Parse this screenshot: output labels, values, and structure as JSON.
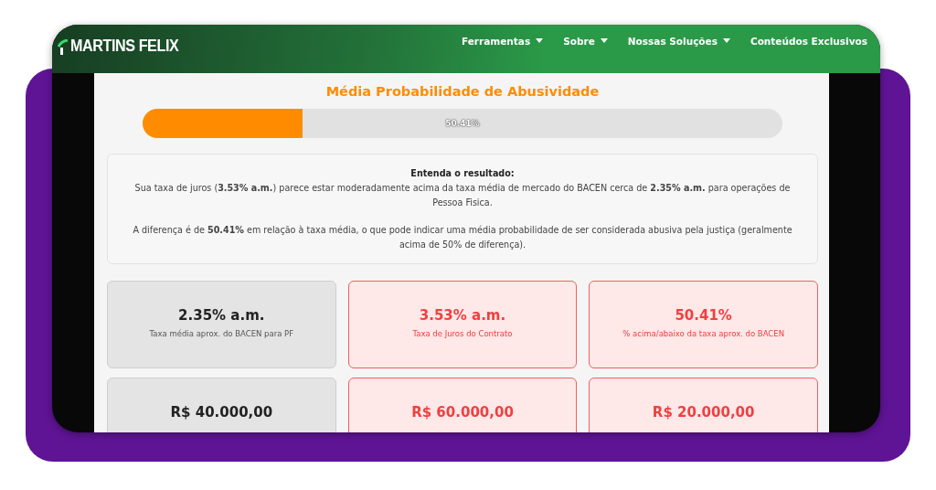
{
  "header": {
    "logo": "MARTINS FELIX",
    "nav": [
      {
        "label": "Ferramentas",
        "dropdown": true
      },
      {
        "label": "Sobre",
        "dropdown": true
      },
      {
        "label": "Nossas Soluções",
        "dropdown": true
      },
      {
        "label": "Conteúdos Exclusivos",
        "dropdown": false
      }
    ]
  },
  "result": {
    "title": "Média Probabilidade de Abusividade",
    "level": 0.25,
    "reading": "50.41%"
  },
  "explanation": {
    "heading": "Entenda o resultado:",
    "paragraphs": [
      "Sua taxa de juros (**3.53% a.m.**) parece estar moderadamente acima da taxa média de mercado do BACEN cerca de **2.35% a.m.** para operações de Pessoa Fisica.",
      "A diferença é de **50.41%** em relação à taxa média, o que pode indicar uma média probabilidade de ser considerada abusiva pela justiça (geralmente acima de 50% de diferença)."
    ]
  },
  "cards": [
    {
      "kind": "neutral",
      "value": "2.35% a.m.",
      "label": "Taxa média aprox. do BACEN para PF"
    },
    {
      "kind": "alert",
      "value": "3.53% a.m.",
      "label": "Taxa de Juros do Contrato"
    },
    {
      "kind": "alert",
      "value": "50.41%",
      "label": "% acima/abaixo da taxa aprox. do BACEN"
    },
    {
      "kind": "neutral",
      "value": "R$ 40.000,00"
    },
    {
      "kind": "alert",
      "value": "R$ 60.000,00"
    },
    {
      "kind": "alert",
      "value": "R$ 20.000,00"
    }
  ]
}
